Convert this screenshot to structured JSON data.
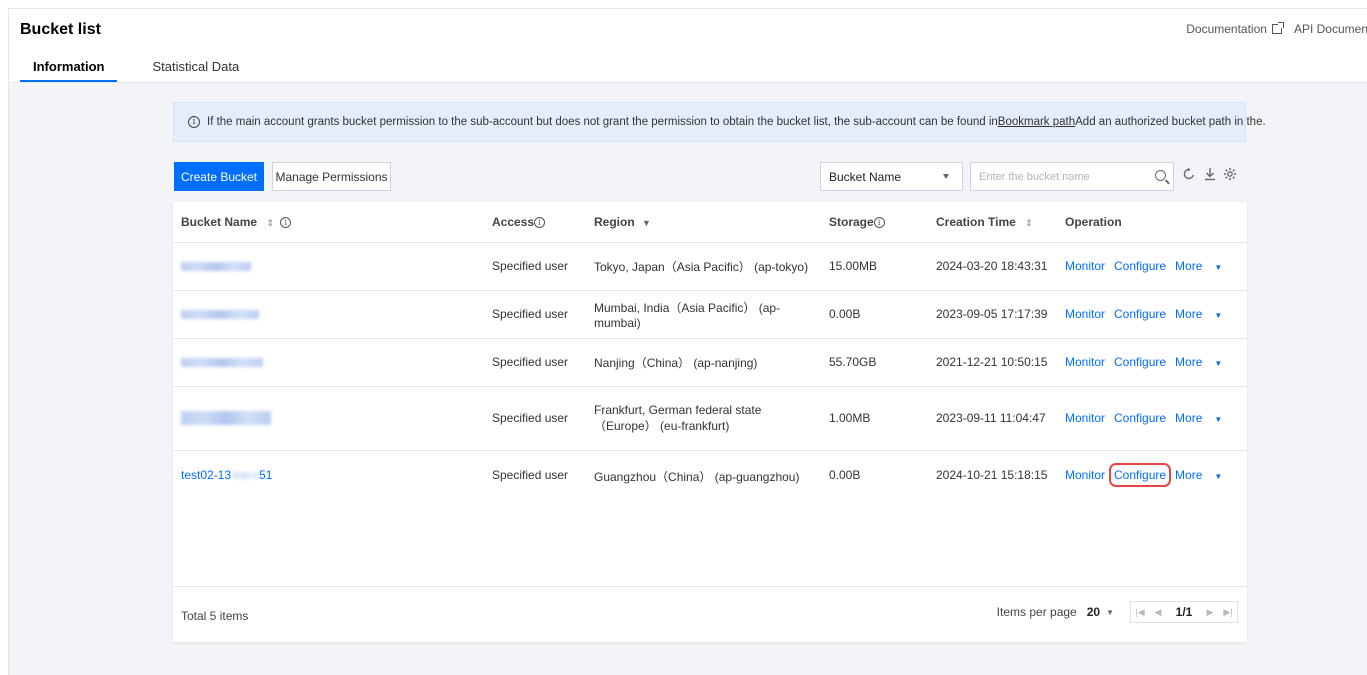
{
  "header": {
    "title": "Bucket list",
    "links": [
      {
        "label": "Documentation",
        "icon": "external-link-icon"
      },
      {
        "label": "API Documen"
      }
    ],
    "tabs": [
      {
        "label": "Information",
        "active": true
      },
      {
        "label": "Statistical Data",
        "active": false
      }
    ]
  },
  "notice": {
    "icon": "info-icon",
    "text_before": "If the main account grants bucket permission to the sub-account but does not grant the permission to obtain the bucket list, the sub-account can be found in",
    "link_text": "Bookmark path",
    "text_after": "Add an authorized bucket path in the."
  },
  "toolbar": {
    "create_label": "Create Bucket",
    "manage_label": "Manage Permissions",
    "filter_selected": "Bucket Name",
    "search_placeholder": "Enter the bucket name",
    "icons": [
      "search-icon",
      "refresh-icon",
      "download-icon",
      "settings-icon"
    ]
  },
  "table": {
    "columns": [
      {
        "label": "Bucket Name",
        "sortable": true,
        "info": true
      },
      {
        "label": "Access",
        "info": true
      },
      {
        "label": "Region",
        "filter": true
      },
      {
        "label": "Storage",
        "info": true
      },
      {
        "label": "Creation Time",
        "sortable": true
      },
      {
        "label": "Operation"
      }
    ],
    "rows": [
      {
        "bucket_name": "",
        "name_redacted": true,
        "access": "Specified user",
        "region": "Tokyo, Japan（Asia Pacific） (ap-tokyo)",
        "storage": "15.00MB",
        "created": "2024-03-20 18:43:31"
      },
      {
        "bucket_name": "",
        "name_redacted": true,
        "access": "Specified user",
        "region": "Mumbai, India（Asia Pacific） (ap-mumbai)",
        "storage": "0.00B",
        "created": "2023-09-05 17:17:39"
      },
      {
        "bucket_name": "",
        "name_redacted": true,
        "access": "Specified user",
        "region": "Nanjing（China） (ap-nanjing)",
        "storage": "55.70GB",
        "created": "2021-12-21 10:50:15"
      },
      {
        "bucket_name": "",
        "name_redacted": true,
        "access": "Specified user",
        "region": "Frankfurt, German federal state（Europe） (eu-frankfurt)",
        "storage": "1.00MB",
        "created": "2023-09-11 11:04:47"
      },
      {
        "bucket_name_prefix": "test02-13",
        "bucket_name_suffix": "51",
        "name_redacted": false,
        "access": "Specified user",
        "region": "Guangzhou（China） (ap-guangzhou)",
        "storage": "0.00B",
        "created": "2024-10-21 15:18:15",
        "highlight_configure": true
      }
    ],
    "operations": {
      "monitor": "Monitor",
      "configure": "Configure",
      "more": "More"
    }
  },
  "footer": {
    "total": "Total 5 items",
    "items_per_page_label": "Items per page",
    "items_per_page_value": "20",
    "page": "1/1"
  },
  "colors": {
    "accent": "#006eff",
    "highlight": "#e54545",
    "notice_bg": "#e5edfb"
  }
}
